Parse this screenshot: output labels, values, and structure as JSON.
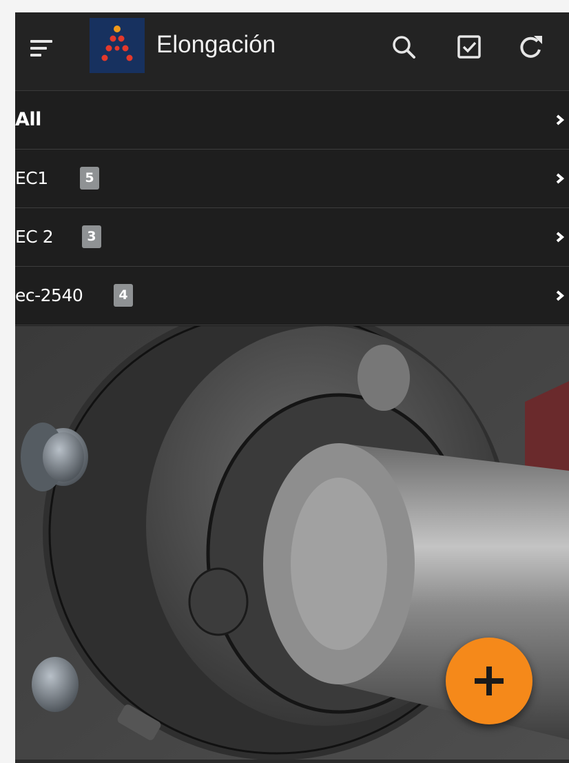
{
  "header": {
    "title": "Elongación",
    "icons": [
      "menu-icon",
      "app-logo",
      "search-icon",
      "checkbox-icon",
      "refresh-icon"
    ]
  },
  "filters": [
    {
      "label": "All",
      "badge": null
    },
    {
      "label": "EC1",
      "badge": "5"
    },
    {
      "label": "EC 2",
      "badge": "3"
    },
    {
      "label": "ec-2540",
      "badge": "4"
    }
  ],
  "fab": {
    "icon": "plus-icon"
  },
  "colors": {
    "accent": "#f5891a",
    "header_bg": "#232323",
    "list_bg": "#1e1e1e",
    "badge_bg": "#8f9294",
    "logo_bg": "#17315f",
    "logo_dots": "#e5392b"
  }
}
